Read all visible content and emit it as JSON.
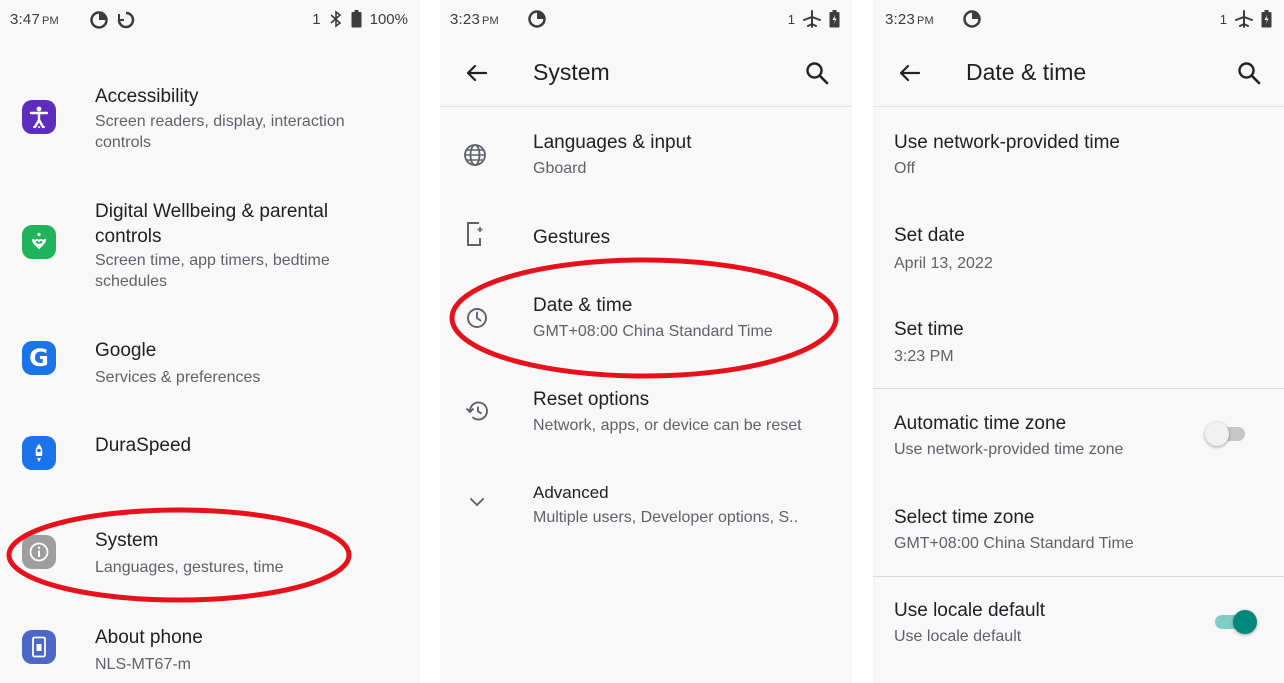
{
  "colors": {
    "annotation_red": "#e8101a",
    "toggle_on": "#00897b",
    "toggle_on_track": "#7fcdc4",
    "accessibility": "#5e2dbd",
    "wellbeing": "#1fb35c",
    "google": "#1a73e8",
    "duraspeed": "#1a73e8",
    "system": "#9e9e9e",
    "about": "#4b67c9"
  },
  "panel1": {
    "status": {
      "time": "3:47",
      "ampm": "PM",
      "sim": "1",
      "battery": "100%"
    },
    "items": [
      {
        "title": "Accessibility",
        "subtitle": "Screen readers, display, interaction controls",
        "icon": "accessibility-icon"
      },
      {
        "title": "Digital Wellbeing & parental controls",
        "subtitle": "Screen time, app timers, bedtime schedules",
        "icon": "wellbeing-icon"
      },
      {
        "title": "Google",
        "subtitle": "Services & preferences",
        "icon": "google-icon"
      },
      {
        "title": "DuraSpeed",
        "subtitle": "",
        "icon": "duraspeed-icon"
      },
      {
        "title": "System",
        "subtitle": "Languages, gestures, time",
        "icon": "info-icon"
      },
      {
        "title": "About phone",
        "subtitle": "NLS-MT67-m",
        "icon": "phone-icon"
      }
    ]
  },
  "panel2": {
    "status": {
      "time": "3:23",
      "ampm": "PM",
      "sim": "1"
    },
    "title": "System",
    "items": [
      {
        "title": "Languages & input",
        "subtitle": "Gboard",
        "icon": "globe-icon"
      },
      {
        "title": "Gestures",
        "subtitle": "",
        "icon": "gesture-phone-icon"
      },
      {
        "title": "Date & time",
        "subtitle": "GMT+08:00 China Standard Time",
        "icon": "clock-icon"
      },
      {
        "title": "Reset options",
        "subtitle": "Network, apps, or device can be reset",
        "icon": "history-icon"
      },
      {
        "title": "Advanced",
        "subtitle": "Multiple users, Developer options, S..",
        "icon": "chevron-down-icon"
      }
    ]
  },
  "panel3": {
    "status": {
      "time": "3:23",
      "ampm": "PM",
      "sim": "1"
    },
    "title": "Date & time",
    "items": [
      {
        "title": "Use network-provided time",
        "subtitle": "Off"
      },
      {
        "title": "Set date",
        "subtitle": "April 13, 2022"
      },
      {
        "title": "Set time",
        "subtitle": "3:23 PM"
      },
      {
        "title": "Automatic time zone",
        "subtitle": "Use network-provided time zone",
        "toggle": "off"
      },
      {
        "title": "Select time zone",
        "subtitle": "GMT+08:00 China Standard Time"
      },
      {
        "title": "Use locale default",
        "subtitle": "Use locale default",
        "toggle": "on"
      }
    ]
  }
}
